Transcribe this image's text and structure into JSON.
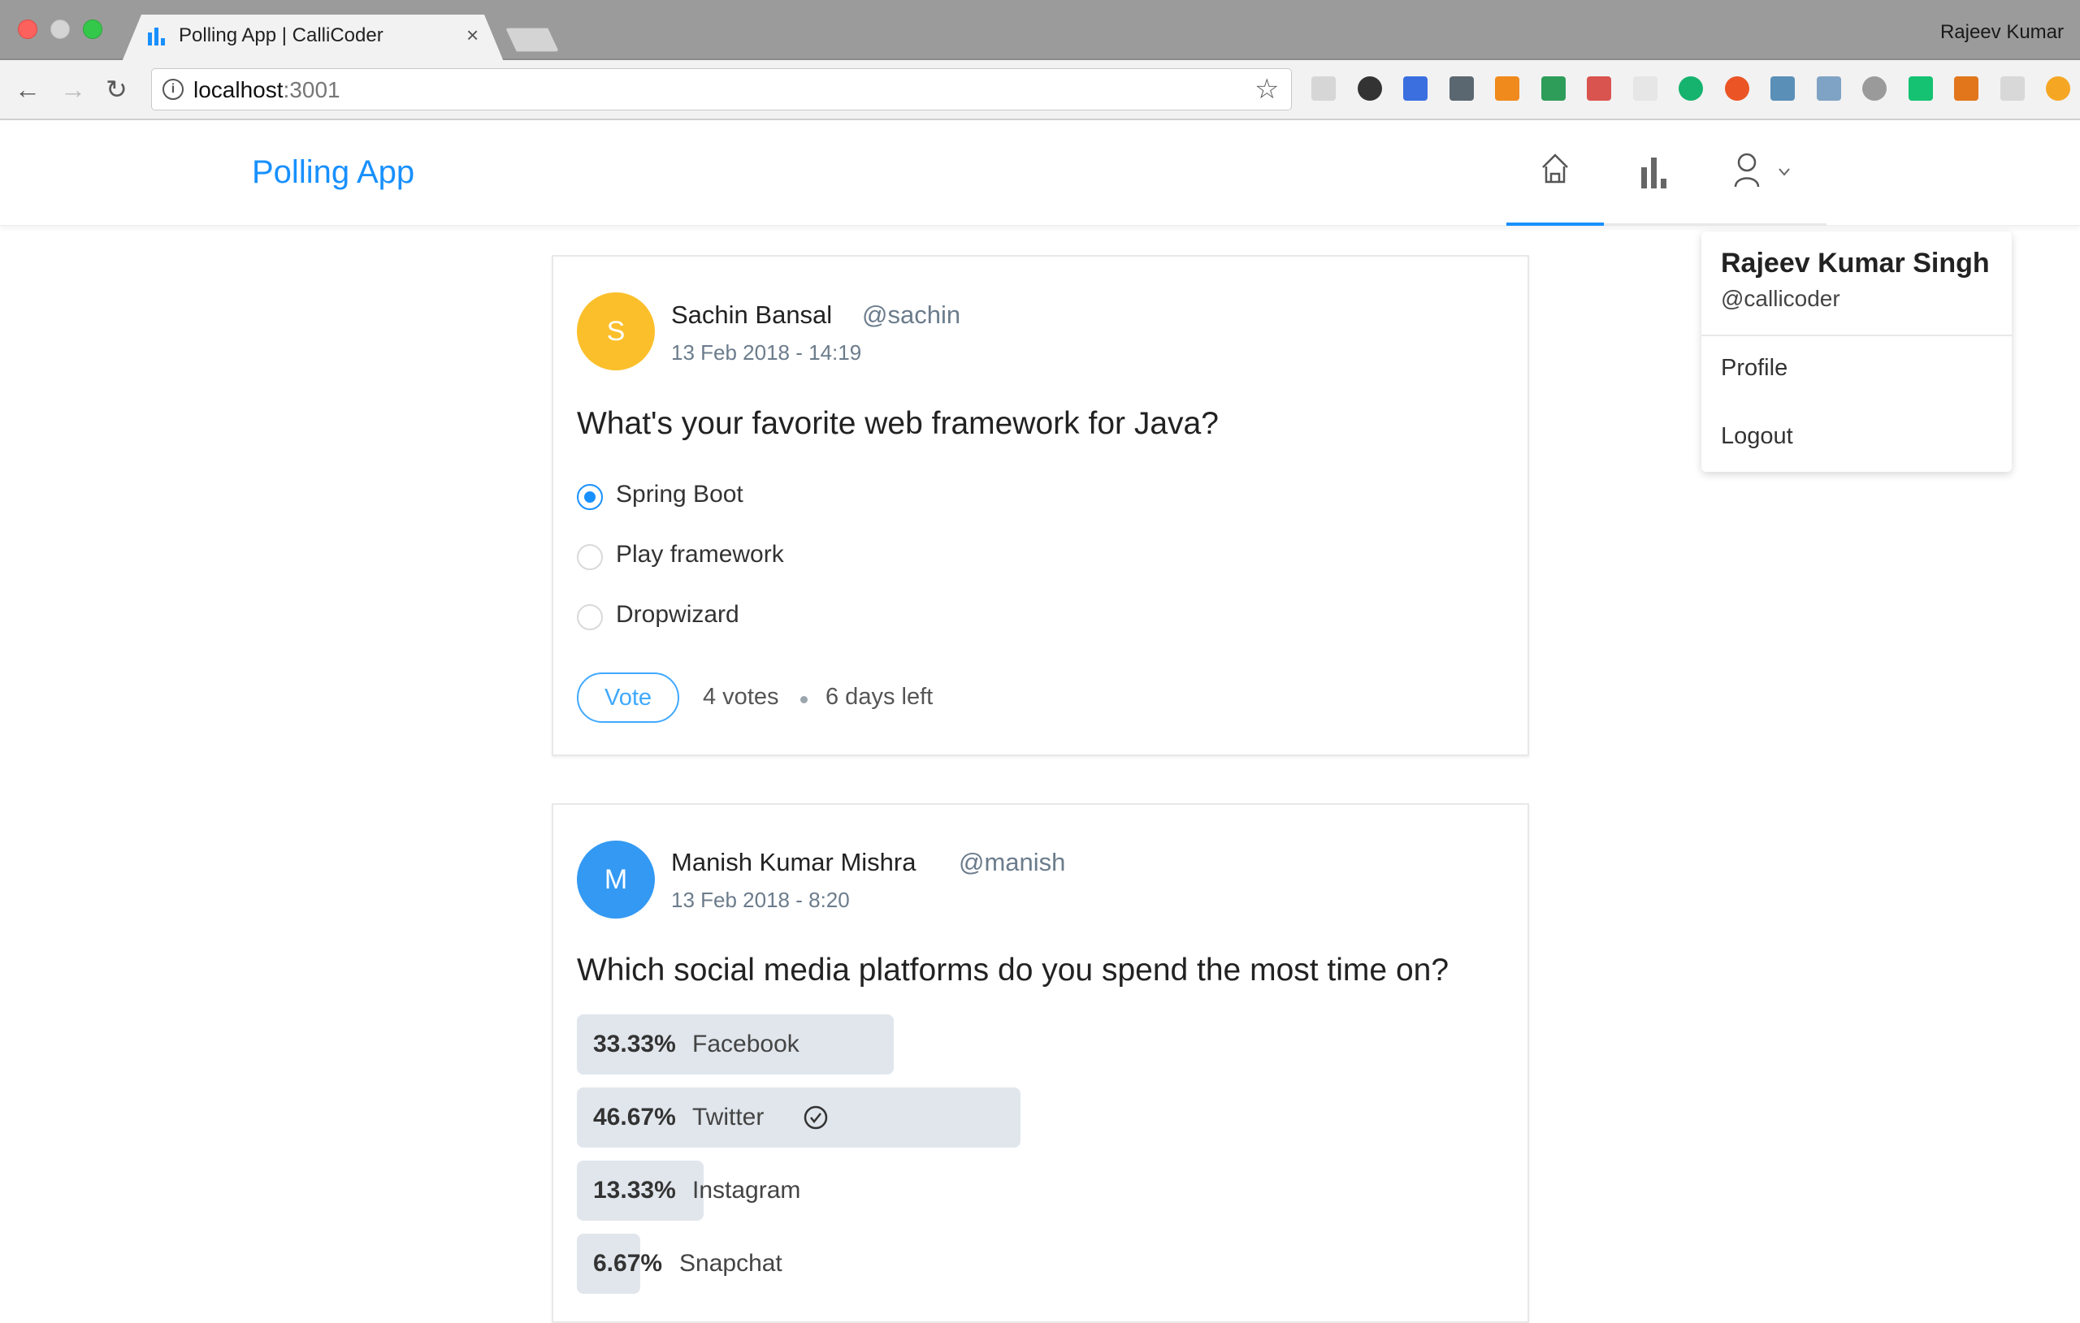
{
  "browser": {
    "tab_title": "Polling App | CalliCoder",
    "close_glyph": "×",
    "profile_name": "Rajeev Kumar",
    "url_host": "localhost",
    "url_port": ":3001",
    "back_glyph": "←",
    "forward_glyph": "→",
    "reload_glyph": "↻",
    "info_glyph": "i",
    "star_glyph": "☆",
    "extensions": [
      {
        "name": "extension-icon-1",
        "color": "#d6d6d6"
      },
      {
        "name": "extension-icon-2",
        "color": "#333333"
      },
      {
        "name": "extension-icon-3",
        "color": "#3b6fe0"
      },
      {
        "name": "extension-icon-4",
        "color": "#5b6770"
      },
      {
        "name": "extension-icon-5",
        "color": "#f08a1c"
      },
      {
        "name": "extension-icon-6",
        "color": "#2e9d5a"
      },
      {
        "name": "extension-icon-7",
        "color": "#d9534f"
      },
      {
        "name": "extension-icon-8",
        "color": "#e6e6e6"
      },
      {
        "name": "extension-icon-9",
        "color": "#15b36e"
      },
      {
        "name": "extension-icon-10",
        "color": "#eb5424"
      },
      {
        "name": "extension-icon-11",
        "color": "#5a8fb8"
      },
      {
        "name": "extension-icon-12",
        "color": "#7fa3c4"
      },
      {
        "name": "extension-icon-13",
        "color": "#9a9a9a"
      },
      {
        "name": "extension-icon-14",
        "color": "#14c272"
      },
      {
        "name": "extension-icon-15",
        "color": "#e2761b"
      },
      {
        "name": "extension-icon-16",
        "color": "#d8d8d8"
      },
      {
        "name": "extension-icon-17",
        "color": "#f5a623"
      }
    ]
  },
  "header": {
    "logo": "Polling App",
    "nav": [
      "home",
      "new-poll",
      "profile-menu"
    ],
    "accent": "#1890ff"
  },
  "user_menu": {
    "name": "Rajeev Kumar Singh",
    "handle": "@callicoder",
    "items": [
      "Profile",
      "Logout"
    ]
  },
  "polls": [
    {
      "avatar_letter": "S",
      "avatar_color": "#fbbf2b",
      "creator_name": "Sachin Bansal",
      "creator_handle": "@sachin",
      "date": "13 Feb 2018 - 14:19",
      "question": "What's your favorite web framework for Java?",
      "choices": [
        {
          "label": "Spring Boot",
          "selected": true
        },
        {
          "label": "Play framework",
          "selected": false
        },
        {
          "label": "Dropwizard",
          "selected": false
        }
      ],
      "vote_label": "Vote",
      "votes": "4 votes",
      "time_left": "6 days left"
    },
    {
      "avatar_letter": "M",
      "avatar_color": "#3399f3",
      "creator_name": "Manish Kumar Mishra",
      "creator_handle": "@manish",
      "date": "13 Feb 2018 - 8:20",
      "question": "Which social media platforms do you spend the most time on?",
      "results": [
        {
          "pct": "33.33%",
          "value": 33.33,
          "label": "Facebook",
          "selected": false
        },
        {
          "pct": "46.67%",
          "value": 46.67,
          "label": "Twitter",
          "selected": true
        },
        {
          "pct": "13.33%",
          "value": 13.33,
          "label": "Instagram",
          "selected": false
        },
        {
          "pct": "6.67%",
          "value": 6.67,
          "label": "Snapchat",
          "selected": false
        }
      ]
    }
  ]
}
